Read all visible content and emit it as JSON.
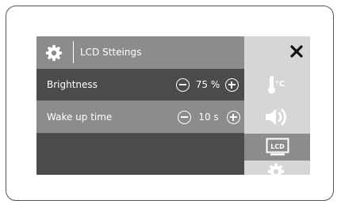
{
  "header": {
    "title": "LCD Stteings"
  },
  "rows": [
    {
      "label": "Brightness",
      "value": "75 %"
    },
    {
      "label": "Wake up time",
      "value": "10 s"
    }
  ],
  "sidebar": {
    "temp_label": "°C",
    "lcd_label": "LCD",
    "icons": [
      "close-icon",
      "thermometer-icon",
      "speaker-icon",
      "lcd-icon",
      "gear-icon"
    ]
  },
  "colors": {
    "header_bg": "#8c8c8c",
    "main_bg": "#4b4b4b",
    "sidebar_bg": "#d6d6d6",
    "selected_bg": "#8c8c8c"
  }
}
